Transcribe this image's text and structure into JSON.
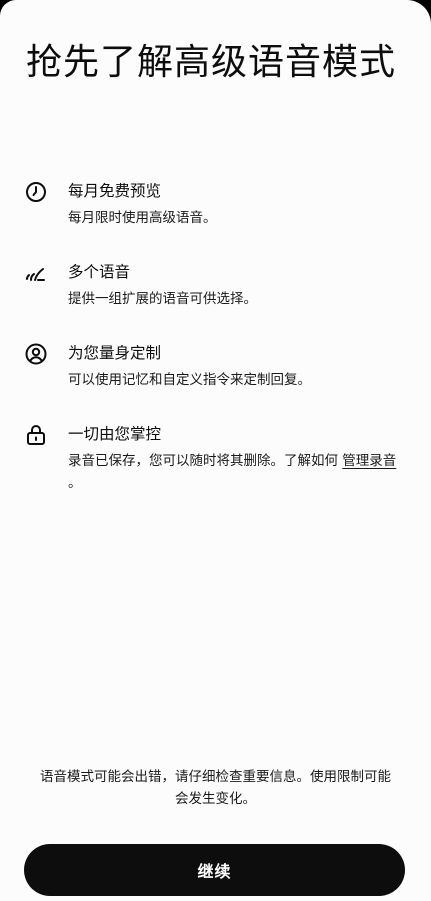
{
  "header": {
    "title": "抢先了解高级语音模式"
  },
  "features": [
    {
      "icon": "clock-icon",
      "title": "每月免费预览",
      "desc": "每月限时使用高级语音。"
    },
    {
      "icon": "voice-wave-icon",
      "title": "多个语音",
      "desc": "提供一组扩展的语音可供选择。"
    },
    {
      "icon": "person-circle-icon",
      "title": "为您量身定制",
      "desc": "可以使用记忆和自定义指令来定制回复。"
    },
    {
      "icon": "lock-icon",
      "title": "一切由您掌控",
      "desc_prefix": " 录音已保存，您可以随时将其删除。了解如何 ",
      "link_label": "管理录音",
      "desc_suffix": " 。"
    }
  ],
  "footer": {
    "disclaimer": "语音模式可能会出错，请仔细检查重要信息。使用限制可能会发生变化。",
    "continue_label": "继续"
  }
}
